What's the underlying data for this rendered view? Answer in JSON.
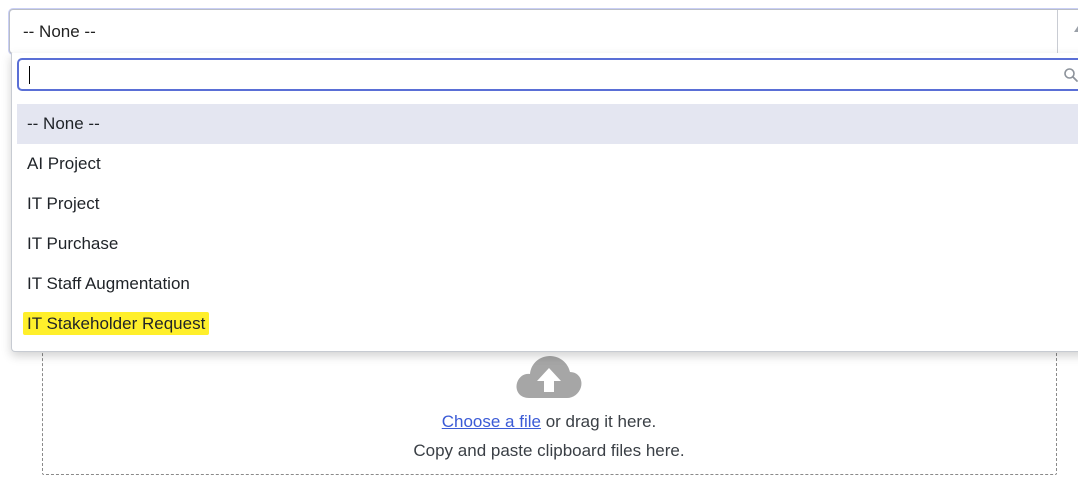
{
  "select": {
    "value": "-- None --"
  },
  "search": {
    "value": "",
    "placeholder": ""
  },
  "options": [
    {
      "label": "-- None --"
    },
    {
      "label": "AI Project"
    },
    {
      "label": "IT Project"
    },
    {
      "label": "IT Purchase"
    },
    {
      "label": "IT Staff Augmentation"
    },
    {
      "label": "IT Stakeholder Request"
    }
  ],
  "upload": {
    "choose_link": "Choose a file",
    "drag_text": " or drag it here.",
    "paste_text": "Copy and paste clipboard files here."
  },
  "colors": {
    "highlight": "#ffef2b",
    "link": "#3b5bd6",
    "focus": "#5a6fd6"
  },
  "icons": {
    "select_arrow": "chevron-up-icon",
    "search": "search-icon",
    "upload": "cloud-upload-icon"
  }
}
